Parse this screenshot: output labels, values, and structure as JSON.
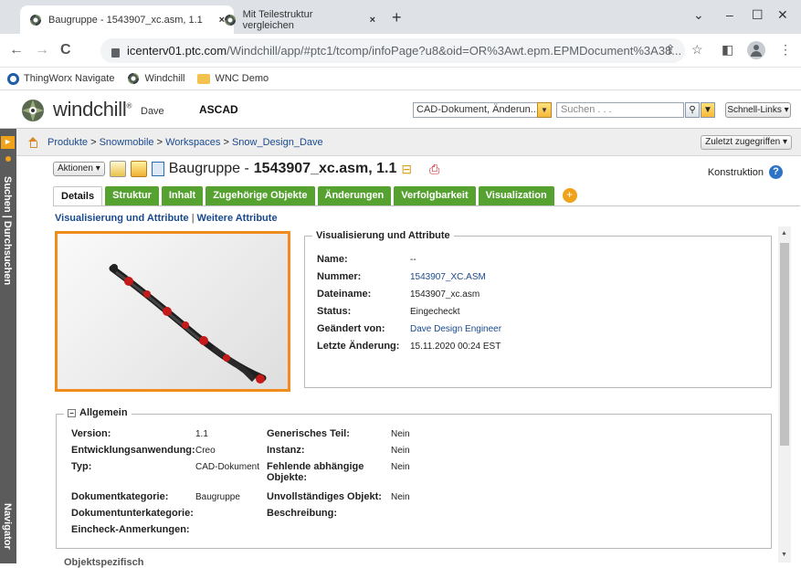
{
  "browser": {
    "tabs": [
      {
        "title": "Baugruppe - 1543907_xc.asm, 1.1",
        "close": "×"
      },
      {
        "title": "Mit Teilestruktur vergleichen",
        "close": "×"
      }
    ],
    "new_tab": "+",
    "window_controls": {
      "minimize": "–",
      "maximize": "☐",
      "close": "✕",
      "menu": "⌄"
    },
    "nav": {
      "back": "←",
      "forward": "→",
      "reload": "C"
    },
    "url_host": "icenterv01.ptc.com",
    "url_rest": "/Windchill/app/#ptc1/tcomp/infoPage?u8&oid=OR%3Awt.epm.EPMDocument%3A38...",
    "bookmarks": [
      "ThingWorx Navigate",
      "Windchill",
      "WNC Demo"
    ]
  },
  "header": {
    "brand": "windchill",
    "trademark": "®",
    "user": "Dave",
    "org": "ASCAD",
    "search_type": "CAD-Dokument, Änderun...",
    "search_placeholder": "Suchen . . .",
    "quick_links": "Schnell-Links ▾"
  },
  "sidebar": {
    "search_label": "Suchen | Durchsuchen",
    "navigator_label": "Navigator",
    "expand": "▸"
  },
  "breadcrumb": {
    "items": [
      "Produkte",
      "Snowmobile",
      "Workspaces",
      "Snow_Design_Dave"
    ],
    "separator": ">",
    "recent": "Zuletzt zugegriffen ▾"
  },
  "object": {
    "actions": "Aktionen ▾",
    "type_label": "Baugruppe - ",
    "name": "1543907_xc.asm, 1.1",
    "context": "Konstruktion",
    "help": "?"
  },
  "tabs": [
    "Details",
    "Struktur",
    "Inhalt",
    "Zugehörige Objekte",
    "Änderungen",
    "Verfolgbarkeit",
    "Visualization"
  ],
  "add_tab": "+",
  "sublinks": {
    "a": "Visualisierung und Attribute",
    "sep": "|",
    "b": "Weitere Attribute"
  },
  "visualization": {
    "title": "Visualisierung und Attribute",
    "fields": [
      {
        "label": "Name:",
        "value": "--",
        "link": false
      },
      {
        "label": "Nummer:",
        "value": "1543907_XC.ASM",
        "link": true
      },
      {
        "label": "Dateiname:",
        "value": "1543907_xc.asm",
        "link": false
      },
      {
        "label": "Status:",
        "value": "Eingecheckt",
        "link": false
      },
      {
        "label": "Geändert von:",
        "value": "Dave Design Engineer",
        "link": true
      },
      {
        "label": "Letzte Änderung:",
        "value": "15.11.2020 00:24 EST",
        "link": false
      }
    ]
  },
  "allgemein": {
    "title": "Allgemein",
    "collapse": "−",
    "left": [
      {
        "label": "Version:",
        "value": "1.1"
      },
      {
        "label": "Entwicklungsanwendung:",
        "value": "Creo"
      },
      {
        "label": "Typ:",
        "value": "CAD-Dokument"
      },
      {
        "label": "Dokumentkategorie:",
        "value": "Baugruppe"
      },
      {
        "label": "Dokumentunterkategorie:",
        "value": ""
      },
      {
        "label": "Eincheck-Anmerkungen:",
        "value": ""
      }
    ],
    "right": [
      {
        "label": "Generisches Teil:",
        "value": "Nein"
      },
      {
        "label": "Instanz:",
        "value": "Nein"
      },
      {
        "label": "Fehlende abhängige Objekte:",
        "value": "Nein"
      },
      {
        "label": "Unvollständiges Objekt:",
        "value": "Nein"
      },
      {
        "label": "Beschreibung:",
        "value": ""
      }
    ]
  },
  "next_section": "Objektspezifisch"
}
